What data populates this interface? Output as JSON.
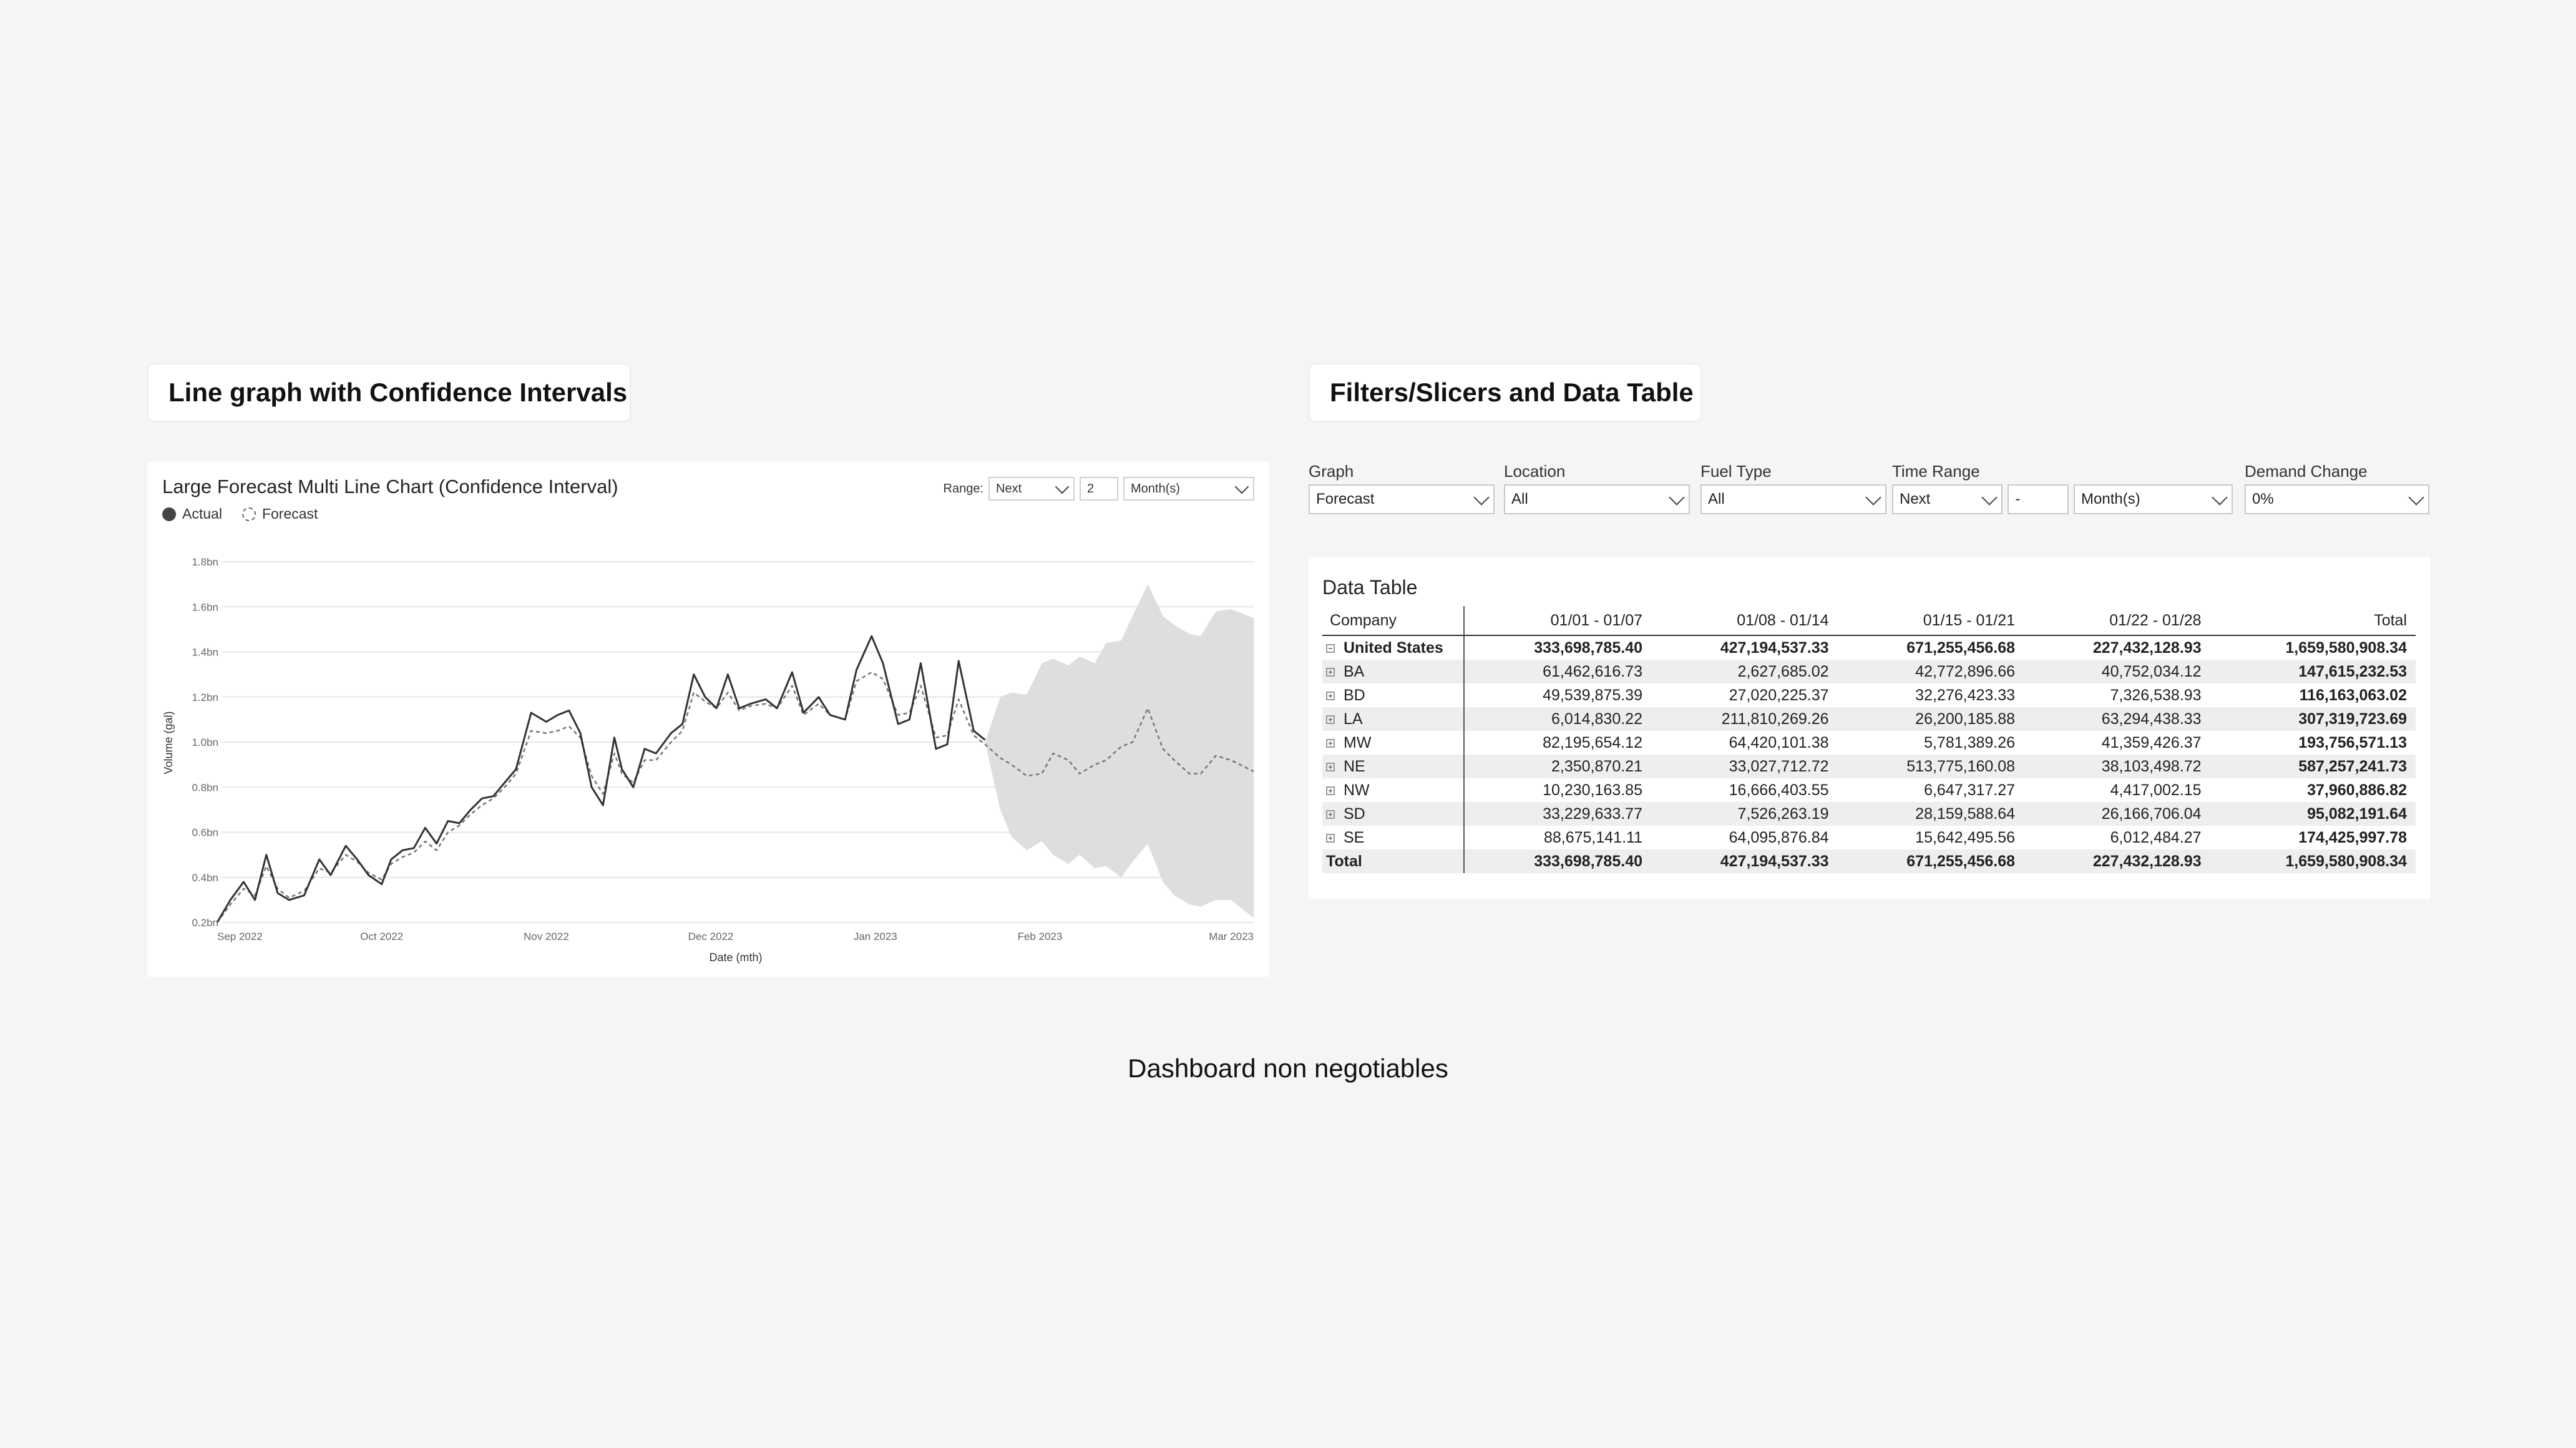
{
  "sections": {
    "left_title": "Line graph with Confidence Intervals",
    "right_title": "Filters/Slicers and Data Table"
  },
  "chart_panel": {
    "title": "Large Forecast Multi Line Chart (Confidence Interval)",
    "legend": {
      "actual": "Actual",
      "forecast": "Forecast"
    },
    "range": {
      "label": "Range:",
      "direction": "Next",
      "count": "2",
      "unit": "Month(s)"
    }
  },
  "chart_data": {
    "type": "line",
    "title": "Large Forecast Multi Line Chart (Confidence Interval)",
    "xlabel": "Date (mth)",
    "ylabel": "Volume (gal)",
    "y_tick_labels": [
      "0.2bn",
      "0.4bn",
      "0.6bn",
      "0.8bn",
      "1.0bn",
      "1.2bn",
      "1.4bn",
      "1.6bn",
      "1.8bn"
    ],
    "y_ticks": [
      0.2,
      0.4,
      0.6,
      0.8,
      1.0,
      1.2,
      1.4,
      1.6,
      1.8
    ],
    "ylim": [
      0.2,
      1.8
    ],
    "x_tick_labels": [
      "Sep 2022",
      "Oct 2022",
      "Nov 2022",
      "Dec 2022",
      "Jan 2023",
      "Feb 2023",
      "Mar 2023"
    ],
    "x_tick_positions": [
      0,
      4.35,
      8.7,
      13.05,
      17.4,
      21.75,
      27.4
    ],
    "grid": true,
    "legend": "top-left",
    "series": [
      {
        "name": "Actual",
        "style": "solid",
        "color": "#333333",
        "x": [
          0,
          0.35,
          0.7,
          1.0,
          1.3,
          1.6,
          1.9,
          2.3,
          2.7,
          3.0,
          3.4,
          3.7,
          4.0,
          4.35,
          4.6,
          4.9,
          5.2,
          5.5,
          5.8,
          6.1,
          6.4,
          6.7,
          7.0,
          7.3,
          7.6,
          7.9,
          8.3,
          8.7,
          9.0,
          9.3,
          9.6,
          9.9,
          10.2,
          10.5,
          10.7,
          11.0,
          11.3,
          11.6,
          12.0,
          12.3,
          12.6,
          12.9,
          13.2,
          13.5,
          13.8,
          14.1,
          14.5,
          14.8,
          15.2,
          15.5,
          15.9,
          16.2,
          16.6,
          16.9,
          17.3,
          17.6,
          18.0,
          18.3,
          18.6,
          19.0,
          19.3,
          19.6,
          20.0,
          20.3
        ],
        "y": [
          0.2,
          0.3,
          0.38,
          0.3,
          0.5,
          0.33,
          0.3,
          0.32,
          0.48,
          0.41,
          0.54,
          0.48,
          0.41,
          0.37,
          0.48,
          0.52,
          0.53,
          0.62,
          0.55,
          0.65,
          0.64,
          0.7,
          0.75,
          0.76,
          0.82,
          0.88,
          1.13,
          1.09,
          1.12,
          1.14,
          1.04,
          0.8,
          0.72,
          1.02,
          0.88,
          0.8,
          0.97,
          0.95,
          1.04,
          1.08,
          1.3,
          1.2,
          1.15,
          1.3,
          1.15,
          1.17,
          1.19,
          1.15,
          1.31,
          1.13,
          1.2,
          1.12,
          1.1,
          1.32,
          1.47,
          1.35,
          1.08,
          1.1,
          1.35,
          0.97,
          0.99,
          1.36,
          1.05,
          1.01
        ]
      },
      {
        "name": "Forecast",
        "style": "dashed",
        "color": "#777777",
        "x": [
          0,
          0.35,
          0.7,
          1.0,
          1.3,
          1.6,
          1.9,
          2.3,
          2.7,
          3.0,
          3.4,
          3.7,
          4.0,
          4.35,
          4.6,
          4.9,
          5.2,
          5.5,
          5.8,
          6.1,
          6.4,
          6.7,
          7.0,
          7.3,
          7.6,
          7.9,
          8.3,
          8.7,
          9.0,
          9.3,
          9.6,
          9.9,
          10.2,
          10.5,
          10.7,
          11.0,
          11.3,
          11.6,
          12.0,
          12.3,
          12.6,
          12.9,
          13.2,
          13.5,
          13.8,
          14.1,
          14.5,
          14.8,
          15.2,
          15.5,
          15.9,
          16.2,
          16.6,
          16.9,
          17.3,
          17.6,
          18.0,
          18.3,
          18.6,
          19.0,
          19.3,
          19.6,
          20.0,
          20.3,
          20.7,
          21.0,
          21.4,
          21.8,
          22.1,
          22.5,
          22.8,
          23.2,
          23.5,
          23.9,
          24.2,
          24.6,
          25.0,
          25.3,
          25.7,
          26.0,
          26.4,
          26.8,
          27.4
        ],
        "y": [
          0.2,
          0.28,
          0.35,
          0.32,
          0.45,
          0.35,
          0.31,
          0.34,
          0.44,
          0.42,
          0.5,
          0.47,
          0.42,
          0.39,
          0.46,
          0.49,
          0.51,
          0.56,
          0.52,
          0.6,
          0.63,
          0.68,
          0.72,
          0.75,
          0.8,
          0.86,
          1.05,
          1.04,
          1.05,
          1.07,
          1.02,
          0.85,
          0.77,
          0.95,
          0.86,
          0.82,
          0.92,
          0.92,
          1.0,
          1.05,
          1.22,
          1.18,
          1.15,
          1.22,
          1.14,
          1.16,
          1.17,
          1.15,
          1.25,
          1.12,
          1.17,
          1.12,
          1.1,
          1.27,
          1.31,
          1.28,
          1.12,
          1.13,
          1.25,
          1.02,
          1.03,
          1.19,
          1.03,
          0.99,
          0.93,
          0.9,
          0.85,
          0.86,
          0.95,
          0.92,
          0.86,
          0.9,
          0.92,
          0.98,
          1.0,
          1.15,
          0.97,
          0.92,
          0.86,
          0.86,
          0.94,
          0.92,
          0.87
        ]
      }
    ],
    "confidence_interval": {
      "name": "Confidence interval",
      "color": "#dedede",
      "x": [
        20.3,
        20.7,
        21.0,
        21.4,
        21.8,
        22.1,
        22.5,
        22.8,
        23.2,
        23.5,
        23.9,
        24.2,
        24.6,
        25.0,
        25.3,
        25.7,
        26.0,
        26.4,
        26.8,
        27.4
      ],
      "upper": [
        1.0,
        1.2,
        1.22,
        1.21,
        1.35,
        1.37,
        1.34,
        1.38,
        1.35,
        1.44,
        1.45,
        1.56,
        1.7,
        1.56,
        1.52,
        1.48,
        1.47,
        1.58,
        1.59,
        1.55
      ],
      "lower": [
        1.0,
        0.7,
        0.58,
        0.52,
        0.56,
        0.5,
        0.46,
        0.5,
        0.44,
        0.45,
        0.4,
        0.47,
        0.55,
        0.38,
        0.32,
        0.28,
        0.27,
        0.3,
        0.3,
        0.22
      ]
    }
  },
  "slicers": [
    {
      "key": "graph",
      "label": "Graph",
      "value": "Forecast"
    },
    {
      "key": "location",
      "label": "Location",
      "value": "All"
    },
    {
      "key": "fuel",
      "label": "Fuel Type",
      "value": "All"
    },
    {
      "key": "time",
      "label": "Time Range",
      "value": "Next",
      "count": "-",
      "unit": "Month(s)"
    },
    {
      "key": "demand",
      "label": "Demand Change",
      "value": "0%"
    }
  ],
  "data_table": {
    "title": "Data Table",
    "headers": [
      "Company",
      "01/01 - 01/07",
      "01/08 - 01/14",
      "01/15 - 01/21",
      "01/22 - 01/28",
      "Total"
    ],
    "rows": [
      {
        "company": "United States",
        "level": 0,
        "expander": "minus",
        "values": [
          "333,698,785.40",
          "427,194,537.33",
          "671,255,456.68",
          "227,432,128.93",
          "1,659,580,908.34"
        ]
      },
      {
        "company": "BA",
        "level": 1,
        "expander": "plus",
        "values": [
          "61,462,616.73",
          "2,627,685.02",
          "42,772,896.66",
          "40,752,034.12",
          "147,615,232.53"
        ]
      },
      {
        "company": "BD",
        "level": 1,
        "expander": "plus",
        "values": [
          "49,539,875.39",
          "27,020,225.37",
          "32,276,423.33",
          "7,326,538.93",
          "116,163,063.02"
        ]
      },
      {
        "company": "LA",
        "level": 1,
        "expander": "plus",
        "values": [
          "6,014,830.22",
          "211,810,269.26",
          "26,200,185.88",
          "63,294,438.33",
          "307,319,723.69"
        ]
      },
      {
        "company": "MW",
        "level": 1,
        "expander": "plus",
        "values": [
          "82,195,654.12",
          "64,420,101.38",
          "5,781,389.26",
          "41,359,426.37",
          "193,756,571.13"
        ]
      },
      {
        "company": "NE",
        "level": 1,
        "expander": "plus",
        "values": [
          "2,350,870.21",
          "33,027,712.72",
          "513,775,160.08",
          "38,103,498.72",
          "587,257,241.73"
        ]
      },
      {
        "company": "NW",
        "level": 1,
        "expander": "plus",
        "values": [
          "10,230,163.85",
          "16,666,403.55",
          "6,647,317.27",
          "4,417,002.15",
          "37,960,886.82"
        ]
      },
      {
        "company": "SD",
        "level": 1,
        "expander": "plus",
        "values": [
          "33,229,633.77",
          "7,526,263.19",
          "28,159,588.64",
          "26,166,706.04",
          "95,082,191.64"
        ]
      },
      {
        "company": "SE",
        "level": 1,
        "expander": "plus",
        "values": [
          "88,675,141.11",
          "64,095,876.84",
          "15,642,495.56",
          "6,012,484.27",
          "174,425,997.78"
        ]
      },
      {
        "company": "Total",
        "level": 2,
        "expander": "none",
        "values": [
          "333,698,785.40",
          "427,194,537.33",
          "671,255,456.68",
          "227,432,128.93",
          "1,659,580,908.34"
        ]
      }
    ]
  },
  "footer": {
    "caption": "Dashboard non negotiables"
  }
}
